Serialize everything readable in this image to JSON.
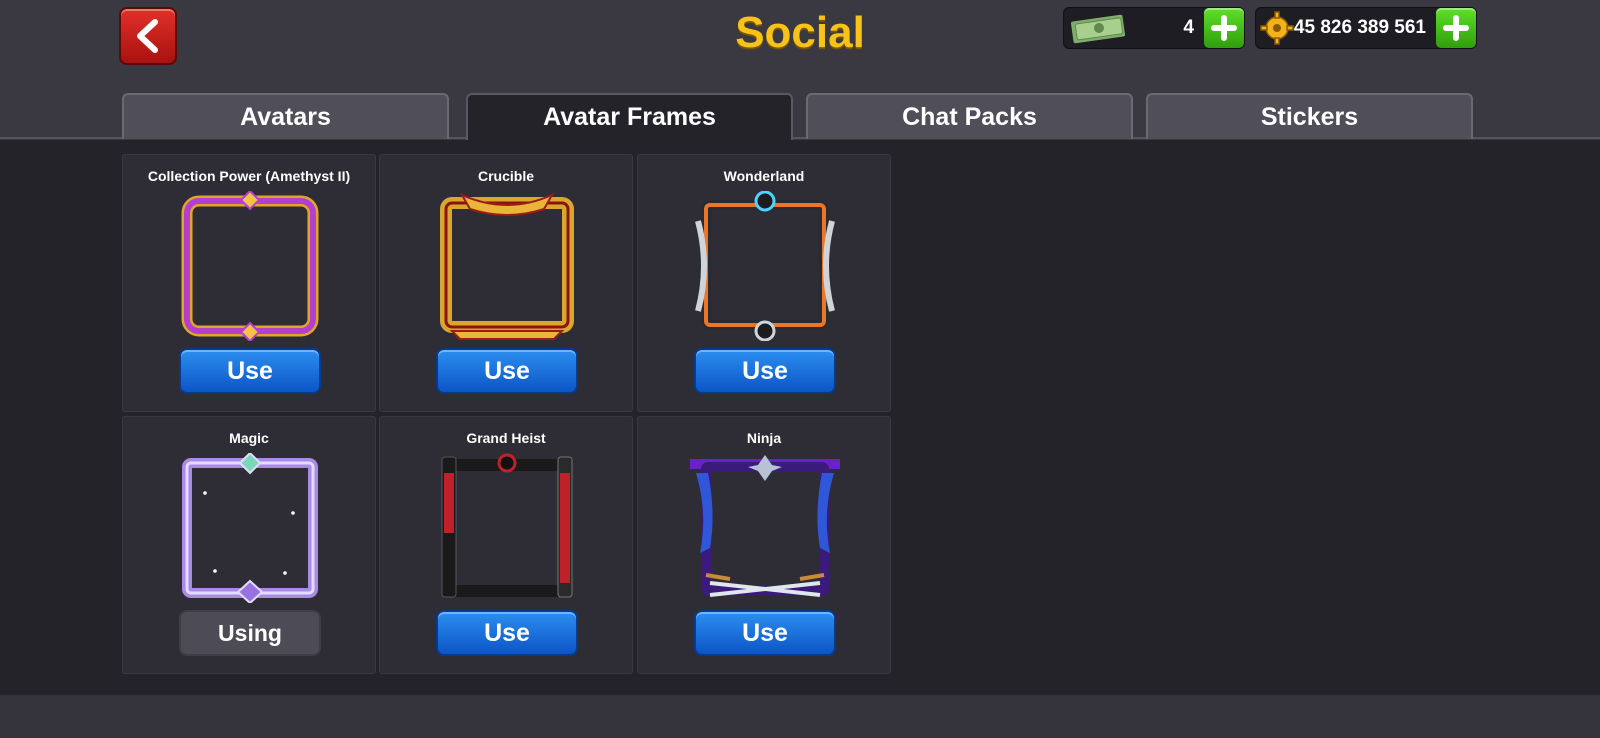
{
  "header": {
    "title": "Social",
    "back_icon": "chevron-left-icon"
  },
  "currency": {
    "cash": {
      "value": "4",
      "icon": "cash-bill-icon"
    },
    "coins": {
      "value": "45 826 389 561",
      "icon": "coin-gear-icon"
    }
  },
  "tabs": [
    {
      "label": "Avatars",
      "active": false
    },
    {
      "label": "Avatar Frames",
      "active": true
    },
    {
      "label": "Chat Packs",
      "active": false
    },
    {
      "label": "Stickers",
      "active": false
    }
  ],
  "frames": [
    {
      "name": "Collection Power (Amethyst II)",
      "button": "Use",
      "colors": [
        "#c64ad8",
        "#f2b233"
      ]
    },
    {
      "name": "Crucible",
      "button": "Use",
      "colors": [
        "#d6a232",
        "#b8201d"
      ]
    },
    {
      "name": "Wonderland",
      "button": "Use",
      "colors": [
        "#e8772a",
        "#cfd4da"
      ]
    },
    {
      "name": "Magic",
      "button": "Using",
      "colors": [
        "#a98ae8",
        "#e4dcff"
      ]
    },
    {
      "name": "Grand Heist",
      "button": "Use",
      "colors": [
        "#c0202a",
        "#1a1a1a"
      ]
    },
    {
      "name": "Ninja",
      "button": "Use",
      "colors": [
        "#6a22c8",
        "#2f57d8"
      ]
    }
  ]
}
